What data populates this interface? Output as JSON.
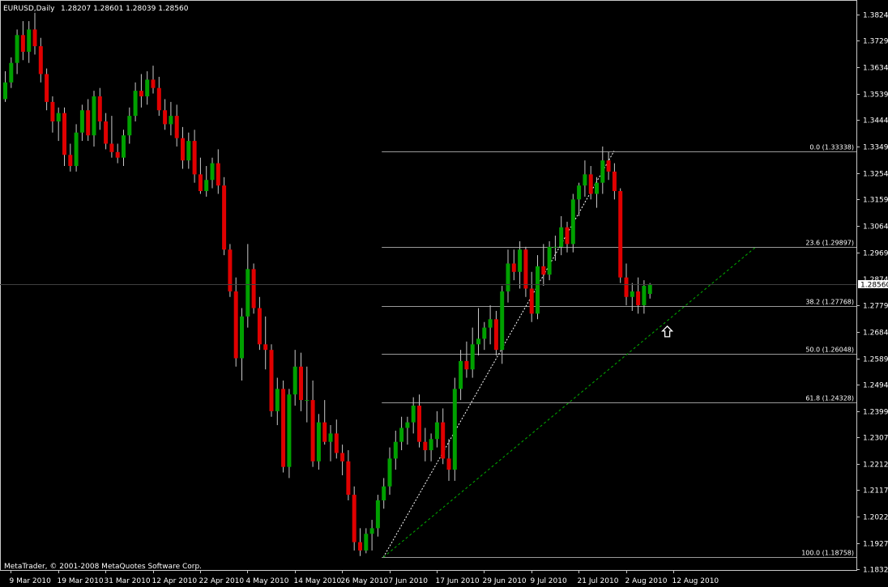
{
  "header": {
    "symbol_label": "EURUSD,Daily",
    "ohlc_text": "1.28207 1.28601 1.28039 1.28560"
  },
  "copyright": "MetaTrader, © 2001-2008 MetaQuotes Software Corp.",
  "colors": {
    "background": "#000000",
    "frame": "#c8c8c8",
    "bull": "#00a000",
    "bear": "#e00000",
    "wick": "#c8c8c8",
    "fib_line": "#9a9a9a",
    "trend_fib": "#ffffff",
    "trend_support": "#00b000",
    "current_price_tag": "#ffffff"
  },
  "chart_data": {
    "type": "candlestick",
    "symbol": "EURUSD",
    "timeframe": "Daily",
    "ylim": [
      1.183,
      1.387
    ],
    "y_ticks": [
      "1.38245",
      "1.37295",
      "1.36345",
      "1.35395",
      "1.34445",
      "1.33495",
      "1.32545",
      "1.31595",
      "1.30645",
      "1.29695",
      "1.27795",
      "1.26845",
      "1.25895",
      "1.24945",
      "1.23995",
      "1.23070",
      "1.22120",
      "1.21170",
      "1.20220",
      "1.19270",
      "1.18320"
    ],
    "current_price": "1.28560",
    "current_price_partial": "1.2874",
    "x_ticks": [
      "9 Mar 2010",
      "19 Mar 2010",
      "31 Mar 2010",
      "12 Apr 2010",
      "22 Apr 2010",
      "4 May 2010",
      "14 May 2010",
      "26 May 2010",
      "7 Jun 2010",
      "17 Jun 2010",
      "29 Jun 2010",
      "9 Jul 2010",
      "21 Jul 2010",
      "2 Aug 2010",
      "12 Aug 2010"
    ],
    "x_tick_bar_index": [
      1,
      9,
      17,
      25,
      33,
      41,
      49,
      57,
      65,
      73,
      81,
      89,
      97,
      105,
      113
    ],
    "candles": [
      [
        1.352,
        1.362,
        1.351,
        1.358
      ],
      [
        1.358,
        1.367,
        1.356,
        1.365
      ],
      [
        1.365,
        1.377,
        1.361,
        1.375
      ],
      [
        1.375,
        1.38,
        1.366,
        1.369
      ],
      [
        1.369,
        1.38,
        1.365,
        1.377
      ],
      [
        1.377,
        1.383,
        1.368,
        1.371
      ],
      [
        1.371,
        1.374,
        1.358,
        1.361
      ],
      [
        1.361,
        1.363,
        1.348,
        1.351
      ],
      [
        1.351,
        1.353,
        1.34,
        1.344
      ],
      [
        1.344,
        1.349,
        1.337,
        1.347
      ],
      [
        1.347,
        1.349,
        1.328,
        1.332
      ],
      [
        1.332,
        1.336,
        1.326,
        1.328
      ],
      [
        1.328,
        1.343,
        1.326,
        1.34
      ],
      [
        1.34,
        1.35,
        1.337,
        1.348
      ],
      [
        1.348,
        1.352,
        1.337,
        1.339
      ],
      [
        1.339,
        1.355,
        1.335,
        1.353
      ],
      [
        1.353,
        1.356,
        1.341,
        1.344
      ],
      [
        1.344,
        1.347,
        1.334,
        1.336
      ],
      [
        1.336,
        1.346,
        1.331,
        1.333
      ],
      [
        1.333,
        1.336,
        1.329,
        1.331
      ],
      [
        1.331,
        1.341,
        1.328,
        1.339
      ],
      [
        1.339,
        1.349,
        1.336,
        1.346
      ],
      [
        1.346,
        1.358,
        1.344,
        1.355
      ],
      [
        1.355,
        1.361,
        1.349,
        1.353
      ],
      [
        1.353,
        1.362,
        1.35,
        1.359
      ],
      [
        1.359,
        1.364,
        1.354,
        1.356
      ],
      [
        1.356,
        1.36,
        1.346,
        1.348
      ],
      [
        1.348,
        1.352,
        1.341,
        1.343
      ],
      [
        1.343,
        1.351,
        1.339,
        1.346
      ],
      [
        1.346,
        1.35,
        1.335,
        1.338
      ],
      [
        1.338,
        1.342,
        1.327,
        1.33
      ],
      [
        1.33,
        1.34,
        1.327,
        1.337
      ],
      [
        1.337,
        1.341,
        1.322,
        1.325
      ],
      [
        1.325,
        1.331,
        1.318,
        1.319
      ],
      [
        1.319,
        1.328,
        1.317,
        1.323
      ],
      [
        1.323,
        1.331,
        1.32,
        1.329
      ],
      [
        1.329,
        1.334,
        1.318,
        1.321
      ],
      [
        1.321,
        1.324,
        1.296,
        1.298
      ],
      [
        1.298,
        1.3,
        1.281,
        1.283
      ],
      [
        1.283,
        1.288,
        1.256,
        1.259
      ],
      [
        1.259,
        1.277,
        1.251,
        1.274
      ],
      [
        1.274,
        1.3,
        1.27,
        1.291
      ],
      [
        1.291,
        1.293,
        1.275,
        1.277
      ],
      [
        1.277,
        1.281,
        1.262,
        1.264
      ],
      [
        1.264,
        1.274,
        1.255,
        1.262
      ],
      [
        1.262,
        1.264,
        1.238,
        1.24
      ],
      [
        1.24,
        1.252,
        1.235,
        1.248
      ],
      [
        1.248,
        1.251,
        1.218,
        1.22
      ],
      [
        1.22,
        1.248,
        1.216,
        1.246
      ],
      [
        1.246,
        1.262,
        1.242,
        1.256
      ],
      [
        1.256,
        1.261,
        1.24,
        1.244
      ],
      [
        1.244,
        1.256,
        1.236,
        1.244
      ],
      [
        1.244,
        1.251,
        1.22,
        1.222
      ],
      [
        1.222,
        1.239,
        1.219,
        1.236
      ],
      [
        1.236,
        1.244,
        1.228,
        1.229
      ],
      [
        1.229,
        1.235,
        1.222,
        1.232
      ],
      [
        1.232,
        1.237,
        1.223,
        1.225
      ],
      [
        1.225,
        1.228,
        1.217,
        1.222
      ],
      [
        1.222,
        1.226,
        1.208,
        1.21
      ],
      [
        1.21,
        1.213,
        1.19,
        1.193
      ],
      [
        1.193,
        1.198,
        1.188,
        1.19
      ],
      [
        1.19,
        1.198,
        1.189,
        1.196
      ],
      [
        1.196,
        1.201,
        1.19,
        1.198
      ],
      [
        1.198,
        1.21,
        1.195,
        1.208
      ],
      [
        1.208,
        1.216,
        1.205,
        1.213
      ],
      [
        1.213,
        1.227,
        1.21,
        1.223
      ],
      [
        1.223,
        1.233,
        1.219,
        1.229
      ],
      [
        1.229,
        1.238,
        1.226,
        1.234
      ],
      [
        1.234,
        1.238,
        1.228,
        1.236
      ],
      [
        1.236,
        1.245,
        1.232,
        1.242
      ],
      [
        1.242,
        1.246,
        1.227,
        1.229
      ],
      [
        1.229,
        1.234,
        1.222,
        1.226
      ],
      [
        1.226,
        1.232,
        1.222,
        1.23
      ],
      [
        1.23,
        1.24,
        1.227,
        1.236
      ],
      [
        1.236,
        1.241,
        1.221,
        1.223
      ],
      [
        1.223,
        1.23,
        1.215,
        1.219
      ],
      [
        1.219,
        1.252,
        1.215,
        1.248
      ],
      [
        1.248,
        1.262,
        1.244,
        1.258
      ],
      [
        1.258,
        1.265,
        1.252,
        1.255
      ],
      [
        1.255,
        1.27,
        1.252,
        1.264
      ],
      [
        1.264,
        1.277,
        1.26,
        1.266
      ],
      [
        1.266,
        1.272,
        1.262,
        1.27
      ],
      [
        1.27,
        1.278,
        1.264,
        1.273
      ],
      [
        1.273,
        1.276,
        1.26,
        1.262
      ],
      [
        1.262,
        1.285,
        1.257,
        1.283
      ],
      [
        1.283,
        1.298,
        1.279,
        1.293
      ],
      [
        1.293,
        1.298,
        1.287,
        1.29
      ],
      [
        1.29,
        1.301,
        1.284,
        1.298
      ],
      [
        1.298,
        1.299,
        1.281,
        1.284
      ],
      [
        1.284,
        1.29,
        1.272,
        1.275
      ],
      [
        1.275,
        1.296,
        1.273,
        1.292
      ],
      [
        1.292,
        1.3,
        1.285,
        1.289
      ],
      [
        1.289,
        1.301,
        1.287,
        1.299
      ],
      [
        1.299,
        1.303,
        1.294,
        1.299
      ],
      [
        1.299,
        1.31,
        1.296,
        1.306
      ],
      [
        1.306,
        1.308,
        1.297,
        1.3
      ],
      [
        1.3,
        1.318,
        1.297,
        1.316
      ],
      [
        1.316,
        1.322,
        1.31,
        1.321
      ],
      [
        1.321,
        1.33,
        1.317,
        1.325
      ],
      [
        1.325,
        1.328,
        1.316,
        1.318
      ],
      [
        1.318,
        1.324,
        1.313,
        1.322
      ],
      [
        1.322,
        1.335,
        1.318,
        1.33
      ],
      [
        1.33,
        1.333,
        1.323,
        1.326
      ],
      [
        1.326,
        1.329,
        1.316,
        1.319
      ],
      [
        1.319,
        1.32,
        1.286,
        1.288
      ],
      [
        1.288,
        1.293,
        1.278,
        1.281
      ],
      [
        1.281,
        1.286,
        1.276,
        1.283
      ],
      [
        1.283,
        1.288,
        1.275,
        1.278
      ],
      [
        1.278,
        1.287,
        1.275,
        1.285
      ],
      [
        1.2821,
        1.286,
        1.2804,
        1.2856
      ]
    ],
    "fibonacci": [
      {
        "label": "0.0 (1.33338)",
        "value": 1.33338
      },
      {
        "label": "23.6 (1.29897)",
        "value": 1.29897
      },
      {
        "label": "38.2 (1.27768)",
        "value": 1.27768
      },
      {
        "label": "50.0 (1.26048)",
        "value": 1.26048
      },
      {
        "label": "61.8 (1.24328)",
        "value": 1.24328
      },
      {
        "label": "100.0 (1.18758)",
        "value": 1.18758
      }
    ],
    "fib_start_bar": 64,
    "fib_anchor": {
      "from_bar": 64,
      "from_value": 1.18758,
      "to_bar": 103,
      "to_value": 1.33338
    },
    "trendline": {
      "from_bar": 64,
      "from_value": 1.18758,
      "to_bar": 127,
      "to_value": 1.299
    },
    "arrow_marker": {
      "bar": 112,
      "value": 1.2705
    }
  }
}
